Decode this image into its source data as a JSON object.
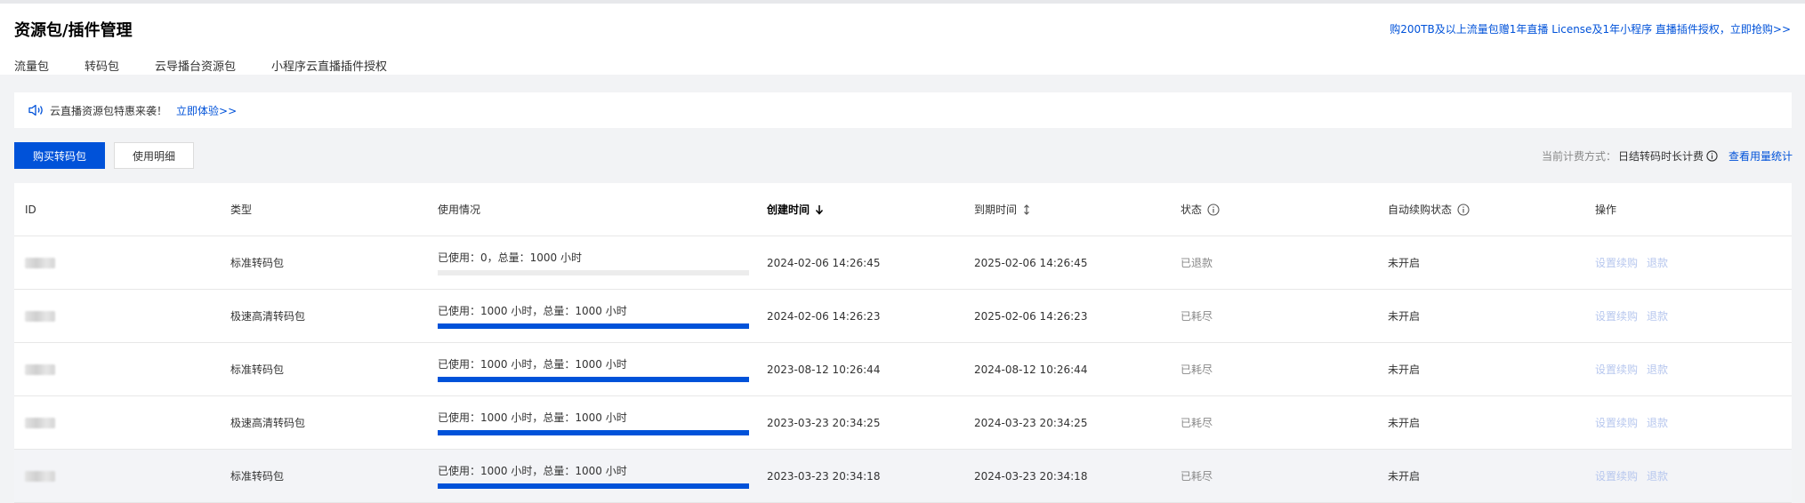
{
  "header": {
    "title": "资源包/插件管理",
    "promo_link": "购200TB及以上流量包赠1年直播 License及1年小程序 直播插件授权，立即抢购>>"
  },
  "tabs": [
    {
      "label": "流量包"
    },
    {
      "label": "转码包"
    },
    {
      "label": "云导播台资源包"
    },
    {
      "label": "小程序云直播插件授权"
    }
  ],
  "notice": {
    "text": "云直播资源包特惠来袭！",
    "link": "立即体验>>",
    "icon": "speaker-icon"
  },
  "toolbar": {
    "buy_label": "购买转码包",
    "detail_label": "使用明细",
    "billing_label": "当前计费方式：",
    "billing_value": "日结转码时长计费",
    "billing_link": "查看用量统计"
  },
  "colors": {
    "accent": "#0052d9",
    "disabled_link": "#b7c7ee"
  },
  "table": {
    "columns": [
      "ID",
      "类型",
      "使用情况",
      "创建时间",
      "到期时间",
      "状态",
      "自动续购状态",
      "操作"
    ],
    "rows": [
      {
        "type": "标准转码包",
        "usage_text": "已使用：0，总量：1000 小时",
        "usage_percent": 0,
        "created": "2024-02-06 14:26:45",
        "expires": "2025-02-06 14:26:45",
        "status": "已退款",
        "auto": "未开启",
        "op1": "设置续购",
        "op2": "退款"
      },
      {
        "type": "极速高清转码包",
        "usage_text": "已使用：1000 小时，总量：1000 小时",
        "usage_percent": 100,
        "created": "2024-02-06 14:26:23",
        "expires": "2025-02-06 14:26:23",
        "status": "已耗尽",
        "auto": "未开启",
        "op1": "设置续购",
        "op2": "退款"
      },
      {
        "type": "标准转码包",
        "usage_text": "已使用：1000 小时，总量：1000 小时",
        "usage_percent": 100,
        "created": "2023-08-12 10:26:44",
        "expires": "2024-08-12 10:26:44",
        "status": "已耗尽",
        "auto": "未开启",
        "op1": "设置续购",
        "op2": "退款"
      },
      {
        "type": "极速高清转码包",
        "usage_text": "已使用：1000 小时，总量：1000 小时",
        "usage_percent": 100,
        "created": "2023-03-23 20:34:25",
        "expires": "2024-03-23 20:34:25",
        "status": "已耗尽",
        "auto": "未开启",
        "op1": "设置续购",
        "op2": "退款"
      },
      {
        "type": "标准转码包",
        "usage_text": "已使用：1000 小时，总量：1000 小时",
        "usage_percent": 100,
        "created": "2023-03-23 20:34:18",
        "expires": "2024-03-23 20:34:18",
        "status": "已耗尽",
        "auto": "未开启",
        "op1": "设置续购",
        "op2": "退款"
      }
    ]
  }
}
